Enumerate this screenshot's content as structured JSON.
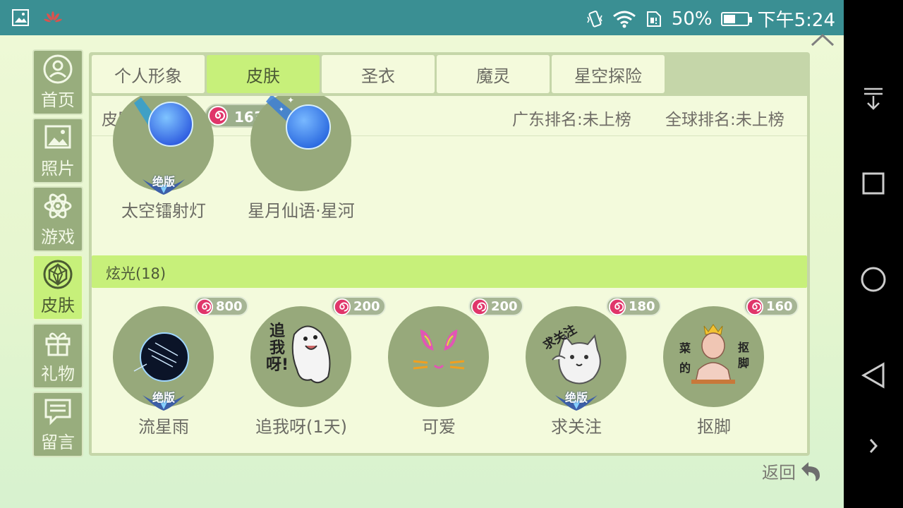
{
  "status_bar": {
    "battery": "50%",
    "battery_level": 0.5,
    "time": "下午5:24"
  },
  "sidebar": {
    "items": [
      {
        "label": "首页",
        "icon": "user-icon"
      },
      {
        "label": "照片",
        "icon": "photo-icon"
      },
      {
        "label": "游戏",
        "icon": "atom-icon"
      },
      {
        "label": "皮肤",
        "icon": "gem-icon",
        "active": true
      },
      {
        "label": "礼物",
        "icon": "gift-icon"
      },
      {
        "label": "留言",
        "icon": "message-icon"
      }
    ]
  },
  "tabs": [
    {
      "label": "个人形象"
    },
    {
      "label": "皮肤",
      "active": true
    },
    {
      "label": "圣衣"
    },
    {
      "label": "魔灵"
    },
    {
      "label": "星空探险"
    }
  ],
  "summary": {
    "total_label": "皮肤总价值:",
    "total_value": "16313",
    "rank_guangdong": "广东排名:未上榜",
    "rank_global": "全球排名:未上榜"
  },
  "top_items": [
    {
      "name": "太空镭射灯",
      "badge": "绝版"
    },
    {
      "name": "星月仙语·星河"
    }
  ],
  "section": {
    "title": "炫光(18)"
  },
  "glow_items": [
    {
      "name": "流星雨",
      "price": "800",
      "badge": "绝版"
    },
    {
      "name": "追我呀(1天)",
      "price": "200",
      "art_text": "追我呀!"
    },
    {
      "name": "可爱",
      "price": "200"
    },
    {
      "name": "求关注",
      "price": "180",
      "badge": "绝版",
      "art_text": "求关注"
    },
    {
      "name": "抠脚",
      "price": "160",
      "art_text_left": "菜的",
      "art_text_right": "抠脚"
    }
  ],
  "footer": {
    "back_label": "返回"
  },
  "colors": {
    "status_bar": "#3a8f93",
    "accent_green": "#c7f07a",
    "circle_green": "#97a97b",
    "coin_pink": "#e0356a"
  }
}
